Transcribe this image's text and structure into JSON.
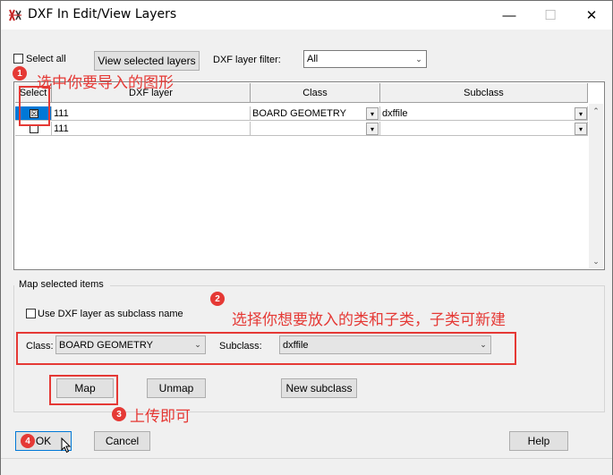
{
  "window": {
    "title": "DXF In Edit/View Layers",
    "icon": "dxf-app-icon",
    "controls": {
      "minimize": "—",
      "maximize": "☐",
      "close": "✕"
    }
  },
  "toolbar": {
    "select_all_label": "Select all",
    "select_all_checked": false,
    "view_selected_label": "View selected layers",
    "filter_label": "DXF layer filter:",
    "filter_value": "All"
  },
  "grid": {
    "columns": [
      "Select",
      "DXF layer",
      "Class",
      "Subclass"
    ],
    "rows": [
      {
        "selected": true,
        "mark": "☒",
        "layer": "111",
        "class": "BOARD GEOMETRY",
        "subclass": "dxffile"
      },
      {
        "selected": false,
        "mark": "",
        "layer": "111",
        "class": "",
        "subclass": ""
      }
    ]
  },
  "map_section": {
    "title": "Map selected items",
    "use_dxf_label": "Use DXF layer as subclass name",
    "use_dxf_checked": false,
    "class_label": "Class:",
    "class_value": "BOARD GEOMETRY",
    "subclass_label": "Subclass:",
    "subclass_value": "dxffile",
    "map_button": "Map",
    "unmap_button": "Unmap",
    "new_subclass_button": "New subclass"
  },
  "footer": {
    "ok_button": "OK",
    "cancel_button": "Cancel",
    "help_button": "Help"
  },
  "annotations": [
    {
      "number": "1",
      "text": "选中你要导入的图形"
    },
    {
      "number": "2",
      "text": "选择你想要放入的类和子类，子类可新建"
    },
    {
      "number": "3",
      "text": "上传即可"
    },
    {
      "number": "4",
      "text": ""
    }
  ],
  "colors": {
    "annotation_red": "#e53935",
    "selection_blue": "#0078d7"
  },
  "icons": [
    "dxf-app-icon",
    "minimize-icon",
    "maximize-icon",
    "close-icon",
    "chevron-down-icon",
    "scroll-up-icon",
    "scroll-down-icon",
    "mouse-cursor-icon"
  ]
}
